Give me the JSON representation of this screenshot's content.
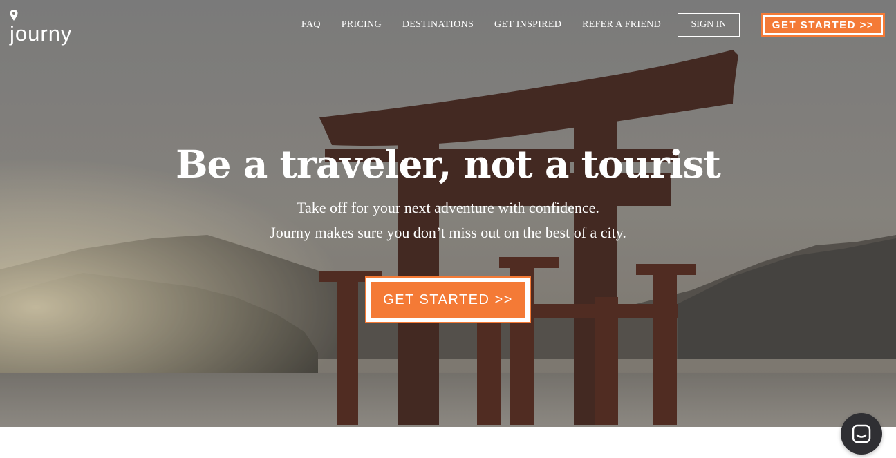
{
  "brand": {
    "logo_text": "journy"
  },
  "nav": {
    "links": [
      {
        "label": "FAQ"
      },
      {
        "label": "PRICING"
      },
      {
        "label": "DESTINATIONS"
      },
      {
        "label": "GET INSPIRED"
      },
      {
        "label": "REFER A FRIEND"
      }
    ],
    "sign_in_label": "SIGN IN",
    "cta_label": "GET STARTED >>"
  },
  "hero": {
    "headline": "Be a traveler, not a tourist",
    "subline_1": "Take off for your next adventure with confidence.",
    "subline_2": "Journy makes sure you don’t miss out on the best of a city.",
    "cta_label": "GET STARTED >>"
  },
  "colors": {
    "accent": "#f47a36",
    "text_on_hero": "#ffffff",
    "chat_launcher": "#2f2f33"
  },
  "icons": {
    "logo_pin": "map-pin-icon",
    "chat": "chat-icon"
  }
}
